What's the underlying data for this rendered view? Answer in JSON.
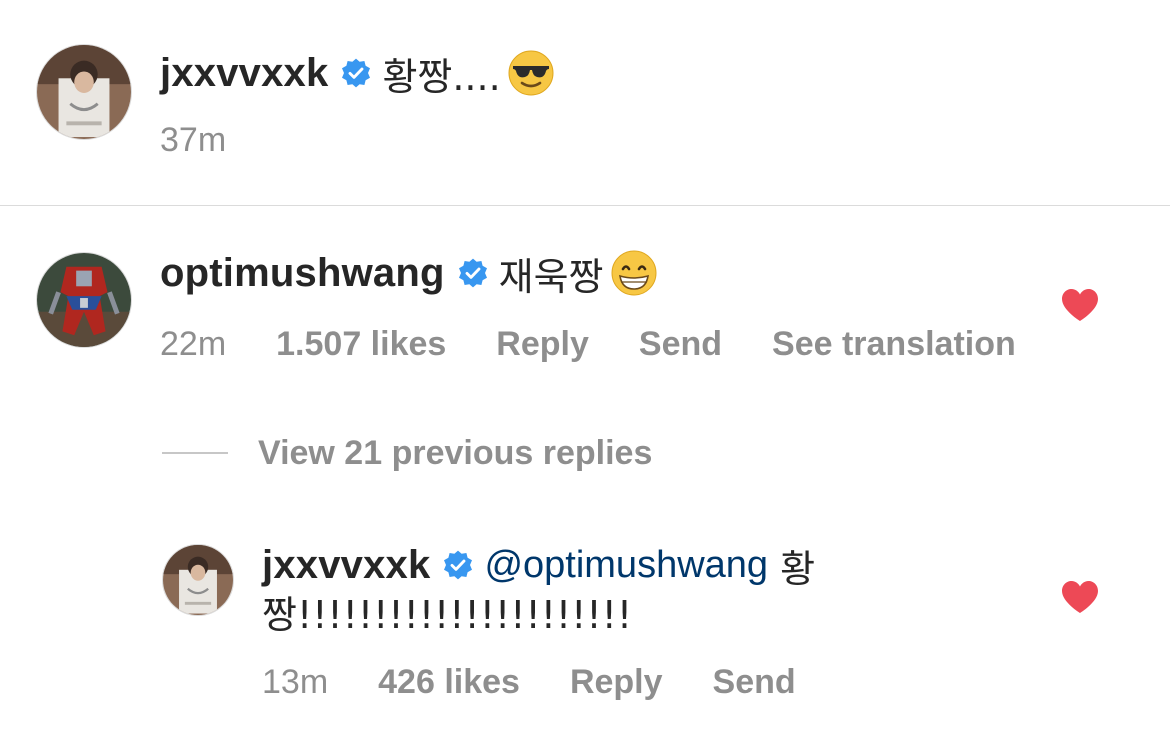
{
  "caption": {
    "username": "jxxvvxxk",
    "text": "황짱....",
    "emoji": "sunglasses-emoji",
    "time": "37m"
  },
  "comment": {
    "username": "optimushwang",
    "text": "재욱짱",
    "emoji": "grinning-emoji",
    "time": "22m",
    "likes": "1.507 likes",
    "reply_label": "Reply",
    "send_label": "Send",
    "translate_label": "See translation",
    "liked": true
  },
  "view_replies": {
    "label": "View 21 previous replies"
  },
  "reply": {
    "username": "jxxvvxxk",
    "mention": "@optimushwang",
    "text_line1": " 황",
    "text_line2": "짱!!!!!!!!!!!!!!!!!!!!!!",
    "time": "13m",
    "likes": "426 likes",
    "reply_label": "Reply",
    "send_label": "Send",
    "liked": true
  },
  "colors": {
    "text": "#262626",
    "secondary": "#8e8e8e",
    "verified": "#3897f0",
    "heart": "#ed4956",
    "mention": "#00376b",
    "divider": "#dbdbdb"
  }
}
